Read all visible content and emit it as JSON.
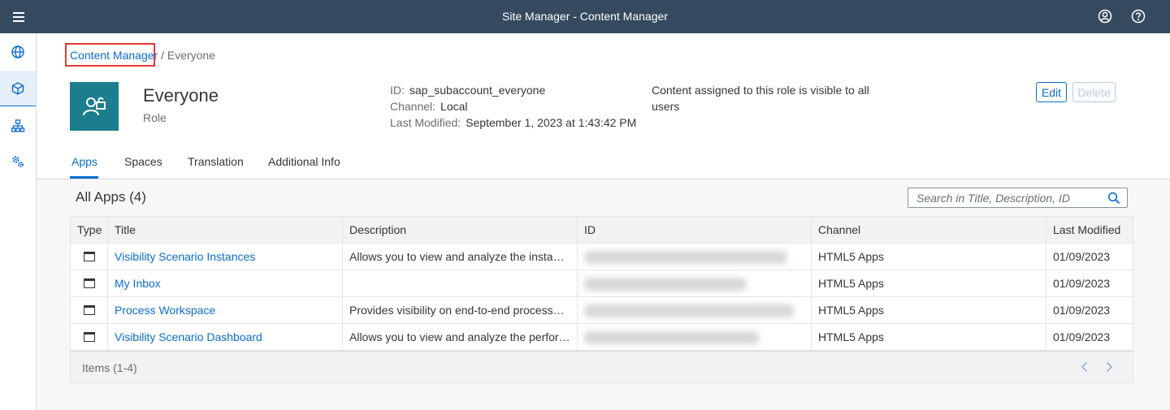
{
  "shell": {
    "title": "Site Manager - Content Manager",
    "icons": [
      "menu-icon",
      "user-icon",
      "help-icon"
    ]
  },
  "sidenav": {
    "items": [
      {
        "name": "globe-icon"
      },
      {
        "name": "cube-icon",
        "active": true
      },
      {
        "name": "hierarchy-icon"
      },
      {
        "name": "settings-icon"
      }
    ]
  },
  "breadcrumb": {
    "link": "Content Manager",
    "separator": "/",
    "current": "Everyone"
  },
  "role": {
    "name": "Everyone",
    "type": "Role",
    "icon": "role-lock-icon",
    "id_label": "ID:",
    "id_value": "sap_subaccount_everyone",
    "channel_label": "Channel:",
    "channel_value": "Local",
    "modified_label": "Last Modified:",
    "modified_value": "September 1, 2023 at 1:43:42 PM",
    "info": "Content assigned to this role is visible to all users"
  },
  "buttons": {
    "edit": "Edit",
    "delete": "Delete"
  },
  "tabs": [
    {
      "label": "Apps",
      "active": true
    },
    {
      "label": "Spaces"
    },
    {
      "label": "Translation"
    },
    {
      "label": "Additional Info"
    }
  ],
  "apps": {
    "title": "All Apps (4)",
    "search_placeholder": "Search in Title, Description, ID",
    "columns": [
      "Type",
      "Title",
      "Description",
      "ID",
      "Channel",
      "Last Modified"
    ],
    "rows": [
      {
        "title": "Visibility Scenario Instances",
        "description": "Allows you to view and analyze the instances of the visibility scenarios",
        "channel": "HTML5 Apps",
        "modified": "01/09/2023"
      },
      {
        "title": "My Inbox",
        "description": "",
        "channel": "HTML5 Apps",
        "modified": "01/09/2023"
      },
      {
        "title": "Process Workspace",
        "description": "Provides visibility on end-to-end processes for business users",
        "channel": "HTML5 Apps",
        "modified": "01/09/2023"
      },
      {
        "title": "Visibility Scenario Dashboard",
        "description": "Allows you to view and analyze the performance of visibility scenarios",
        "channel": "HTML5 Apps",
        "modified": "01/09/2023"
      }
    ],
    "footer": "Items (1-4)"
  },
  "colors": {
    "shell": "#354a5f",
    "accent": "#0a6ed1",
    "role_tile": "#1b7e8e",
    "highlight": "#e53935"
  }
}
